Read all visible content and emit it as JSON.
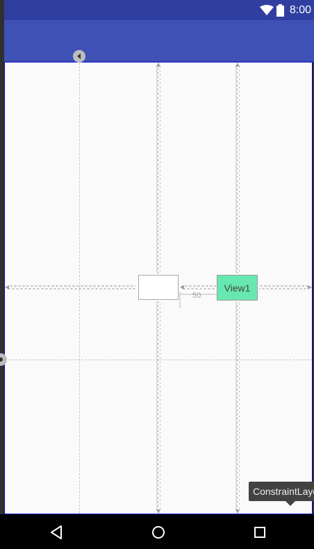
{
  "status_bar": {
    "time": "8:00",
    "icons": [
      "wifi-icon",
      "battery-icon"
    ],
    "color": "#303f9f"
  },
  "app_bar": {
    "color": "#3f51b5"
  },
  "canvas": {
    "background": "#fafafa",
    "widgets": {
      "view1": {
        "label": "View1",
        "color": "#66e8b0"
      },
      "empty_view": {
        "label": ""
      }
    },
    "constraint_margin": "50"
  },
  "tooltip": {
    "text": "ConstraintLayout"
  },
  "nav_bar": {
    "buttons": [
      "back-icon",
      "home-icon",
      "recents-icon"
    ]
  }
}
